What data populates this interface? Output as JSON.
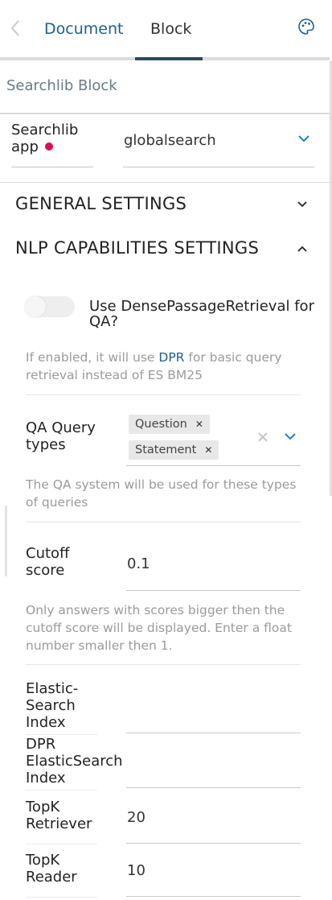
{
  "topbar": {
    "tabs": [
      {
        "label": "Document"
      },
      {
        "label": "Block"
      }
    ]
  },
  "block_title": "Searchlib Block",
  "searchlib_app": {
    "label": "Searchlib app",
    "value": "globalsearch"
  },
  "sections": {
    "general": "GENERAL SETTINGS",
    "nlp": "NLP CAPABILITIES SETTINGS"
  },
  "dpr_toggle": {
    "label": "Use DensePassageRetrieval for QA?",
    "help_before": "If enabled, it will use ",
    "help_link": "DPR",
    "help_after": " for basic query retrieval instead of ES BM25"
  },
  "qa_query_types": {
    "label": "QA Query types",
    "chips": [
      "Question",
      "Statement"
    ],
    "help": "The QA system will be used for these types of queries"
  },
  "cutoff": {
    "label": "Cutoff score",
    "value": "0.1",
    "help": "Only answers with scores bigger then the cutoff score will be displayed. Enter a float number smaller then 1."
  },
  "es_index": {
    "label": "Elastic-Search Index",
    "value": ""
  },
  "dpr_es_index": {
    "label": "DPR ElasticSearch Index",
    "value": ""
  },
  "topk_retriever": {
    "label": "TopK Retriever",
    "value": "20"
  },
  "topk_reader": {
    "label": "TopK Reader",
    "value": "10"
  },
  "colors": {
    "accent": "#1f5f8b",
    "required": "#d80e57",
    "tab_indicator": "#2d4b57"
  }
}
